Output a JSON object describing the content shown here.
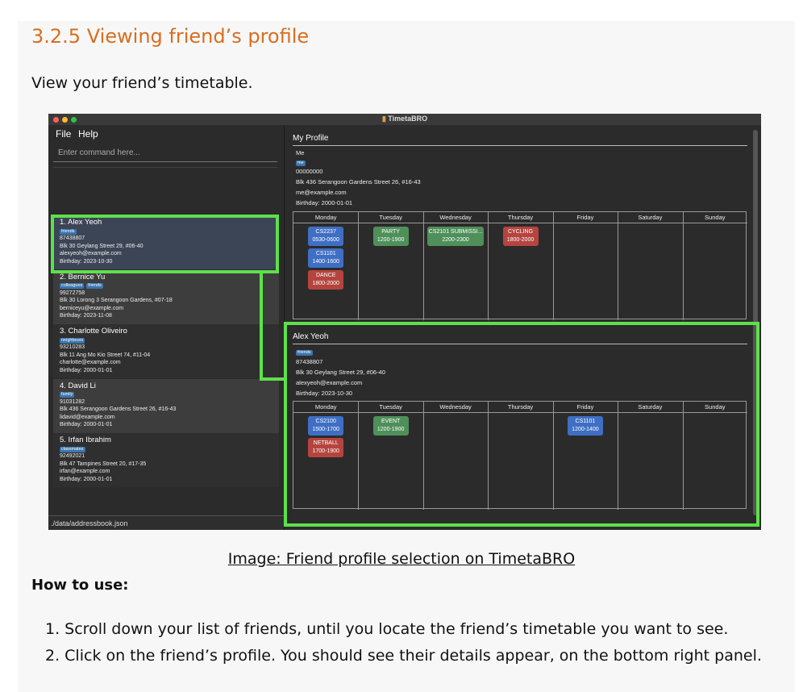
{
  "heading": "3.2.5 Viewing friend’s profile",
  "intro": "View your friend’s timetable.",
  "app": {
    "window_title": "TimetaBRO",
    "menu": [
      "File",
      "Help"
    ],
    "command_placeholder": "Enter command here...",
    "status_path": "./data/addressbook.json",
    "persons": [
      {
        "name": "1.  Alex Yeoh",
        "tags": [
          "friends"
        ],
        "phone": "87438807",
        "address": "Blk 30 Geylang Street 29, #06-40",
        "email": "alexyeoh@example.com",
        "birthday": "Birthday: 2023-10-30"
      },
      {
        "name": "2.  Bernice Yu",
        "tags": [
          "colleagues",
          "friends"
        ],
        "phone": "99272758",
        "address": "Blk 30 Lorong 3 Serangoon Gardens, #07-18",
        "email": "berniceyu@example.com",
        "birthday": "Birthday: 2023-11-08"
      },
      {
        "name": "3.  Charlotte Oliveiro",
        "tags": [
          "neighbours"
        ],
        "phone": "93210283",
        "address": "Blk 11 Ang Mo Kio Street 74, #11-04",
        "email": "charlotte@example.com",
        "birthday": "Birthday: 2000-01-01"
      },
      {
        "name": "4.  David Li",
        "tags": [
          "family"
        ],
        "phone": "91031282",
        "address": "Blk 436 Serangoon Gardens Street 26, #16-43",
        "email": "lidavid@example.com",
        "birthday": "Birthday: 2000-01-01"
      },
      {
        "name": "5.  Irfan Ibrahim",
        "tags": [
          "classmates"
        ],
        "phone": "92492021",
        "address": "Blk 47 Tampines Street 20, #17-35",
        "email": "irfan@example.com",
        "birthday": "Birthday: 2000-01-01"
      }
    ],
    "my_profile": {
      "title": "My Profile",
      "name": "Me",
      "tag": "me",
      "phone": "00000000",
      "address": "Blk 436 Serangoon Gardens Street 26, #16-43",
      "email": "me@example.com",
      "birthday": "Birthday: 2000-01-01"
    },
    "friend_profile": {
      "title": "Alex Yeoh",
      "tag": "friends",
      "phone": "87438807",
      "address": "Blk 30 Geylang Street 29, #06-40",
      "email": "alexyeoh@example.com",
      "birthday": "Birthday: 2023-10-30"
    },
    "days": [
      "Monday",
      "Tuesday",
      "Wednesday",
      "Thursday",
      "Friday",
      "Saturday",
      "Sunday"
    ],
    "my_events": [
      {
        "day": 0,
        "slot": 0,
        "name": "CS2237",
        "time": "0530-0600",
        "color": "#3f6fc4"
      },
      {
        "day": 0,
        "slot": 1,
        "name": "CS1101",
        "time": "1400-1600",
        "color": "#3f6fc4"
      },
      {
        "day": 0,
        "slot": 2,
        "name": "DANCE",
        "time": "1800-2000",
        "color": "#b5443f"
      },
      {
        "day": 1,
        "slot": 0,
        "name": "PARTY",
        "time": "1200-1900",
        "color": "#4f8f5a"
      },
      {
        "day": 2,
        "slot": 0,
        "name": "CS2101 SUBMISSI...",
        "time": "2200-2300",
        "color": "#4f8f5a"
      },
      {
        "day": 3,
        "slot": 0,
        "name": "CYCLING",
        "time": "1800-2000",
        "color": "#b5443f"
      }
    ],
    "friend_events": [
      {
        "day": 0,
        "slot": 0,
        "name": "CS2100",
        "time": "1500-1700",
        "color": "#3f6fc4"
      },
      {
        "day": 0,
        "slot": 1,
        "name": "NETBALL",
        "time": "1700-1900",
        "color": "#b5443f"
      },
      {
        "day": 1,
        "slot": 0,
        "name": "EVENT",
        "time": "1200-1900",
        "color": "#4f8f5a"
      },
      {
        "day": 4,
        "slot": 0,
        "name": "CS1101",
        "time": "1200-1400",
        "color": "#3f6fc4"
      }
    ]
  },
  "caption": "Image: Friend profile selection on TimetaBRO",
  "howto": "How to use:",
  "steps": [
    "1. Scroll down your list of friends, until you locate the friend’s timetable you want to see.",
    "2. Click on the friend’s profile. You should see their details appear, on the bottom right panel."
  ]
}
